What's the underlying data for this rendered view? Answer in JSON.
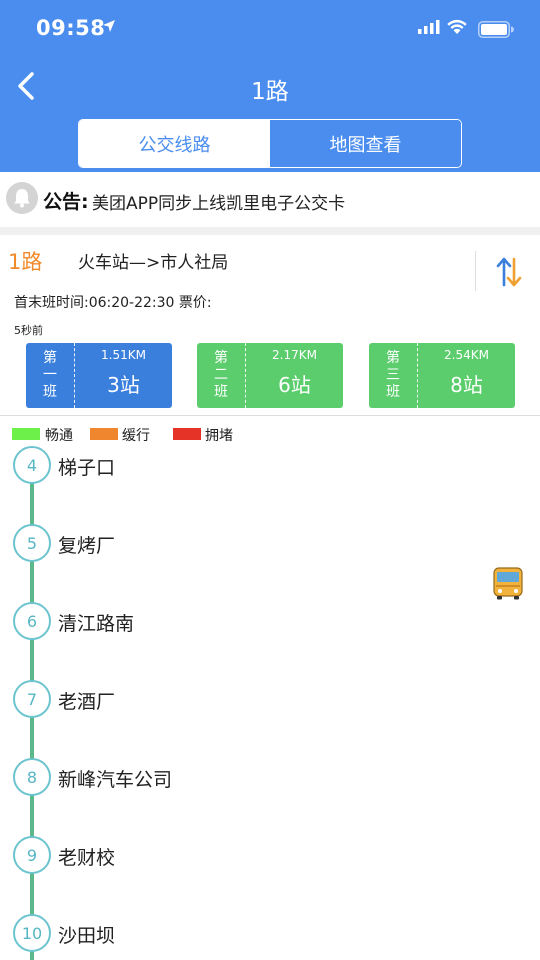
{
  "status_bar": {
    "time": "09:58"
  },
  "nav": {
    "title": "1路"
  },
  "tabs": [
    {
      "label": "公交线路",
      "active": true
    },
    {
      "label": "地图查看",
      "active": false
    }
  ],
  "notice": {
    "label": "公告:",
    "text": "美团APP同步上线凯里电子公交卡"
  },
  "route": {
    "number": "1路",
    "direction": "火车站—>市人社局",
    "schedule": "首末班时间:06:20-22:30  票价:",
    "updated": "5秒前"
  },
  "bus_cards": [
    {
      "order_chars": [
        "第",
        "一",
        "班"
      ],
      "distance": "1.51KM",
      "stops": "3站",
      "color": "blue"
    },
    {
      "order_chars": [
        "第",
        "二",
        "班"
      ],
      "distance": "2.17KM",
      "stops": "6站",
      "color": "green"
    },
    {
      "order_chars": [
        "第",
        "三",
        "班"
      ],
      "distance": "2.54KM",
      "stops": "8站",
      "color": "green"
    }
  ],
  "legend": [
    {
      "label": "畅通",
      "color": "#6ef04a"
    },
    {
      "label": "缓行",
      "color": "#f0872e"
    },
    {
      "label": "拥堵",
      "color": "#e53427"
    }
  ],
  "stations": [
    {
      "num": "4",
      "name": "梯子口"
    },
    {
      "num": "5",
      "name": "复烤厂"
    },
    {
      "num": "6",
      "name": "清江路南"
    },
    {
      "num": "7",
      "name": "老酒厂"
    },
    {
      "num": "8",
      "name": "新峰汽车公司"
    },
    {
      "num": "9",
      "name": "老财校"
    },
    {
      "num": "10",
      "name": "沙田坝"
    }
  ],
  "colors": {
    "header": "#4a8def",
    "route_number": "#f08a2a",
    "line": "#5cb88a",
    "station_ring": "#6cc4cf"
  }
}
